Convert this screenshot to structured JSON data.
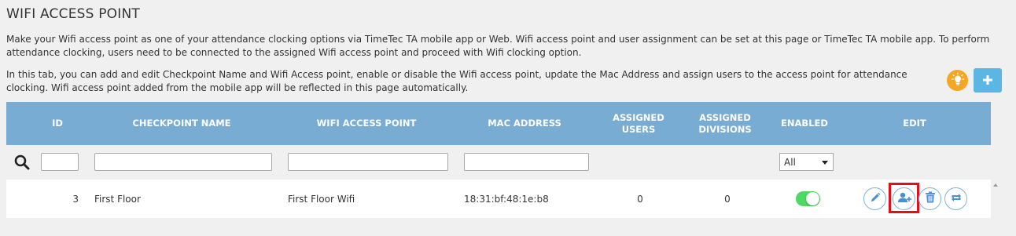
{
  "page": {
    "title": "WIFI ACCESS POINT",
    "description_1": "Make your Wifi access point as one of your attendance clocking options via TimeTec TA mobile app or Web. Wifi access point and user assignment can be set at this page or TimeTec TA mobile app. To perform attendance clocking, users need to be connected to the assigned Wifi access point and proceed with Wifi clocking option.",
    "description_2": "In this tab, you can add and edit Checkpoint Name and Wifi Access point, enable or disable the Wifi access point, update the Mac Address and assign users to the access point for attendance clocking. Wifi access point added from the mobile app will be reflected in this page automatically."
  },
  "toolbar": {
    "tips_icon": "lightbulb-icon",
    "add_icon": "plus-icon",
    "tips_color": "#f5a623",
    "add_color": "#5bb6e3"
  },
  "table": {
    "header_color": "#78acd3",
    "columns": {
      "id": "ID",
      "checkpoint_name": "CHECKPOINT NAME",
      "wifi_access_point": "WIFI ACCESS POINT",
      "mac_address": "MAC ADDRESS",
      "assigned_users_1": "ASSIGNED",
      "assigned_users_2": "USERS",
      "assigned_divisions_1": "ASSIGNED",
      "assigned_divisions_2": "DIVISIONS",
      "enabled": "ENABLED",
      "edit": "EDIT"
    },
    "filter": {
      "enabled_select_value": "All"
    },
    "rows": [
      {
        "id": "3",
        "checkpoint_name": "First Floor",
        "wifi_access_point": "First Floor Wifi",
        "mac_address": "18:31:bf:48:1e:b8",
        "assigned_users": "0",
        "assigned_divisions": "0",
        "enabled": true
      }
    ],
    "actions": [
      "pencil-icon",
      "assign-user-icon",
      "trash-icon",
      "refresh-icon"
    ],
    "toggle_on_color": "#4cd964",
    "highlight_color": "#e0101a"
  }
}
